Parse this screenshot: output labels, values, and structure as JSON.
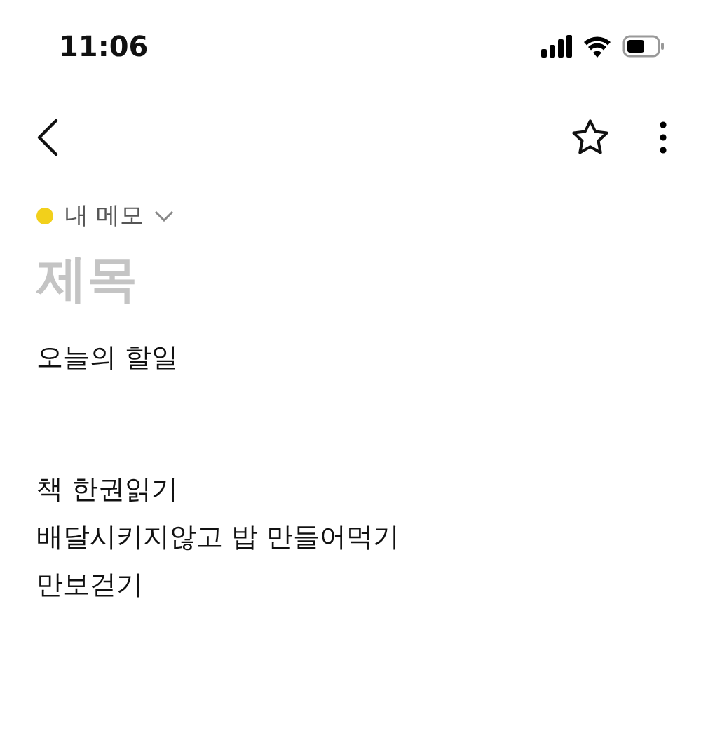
{
  "status_bar": {
    "time": "11:06"
  },
  "note": {
    "folder": {
      "name": "내 메모",
      "color": "#f2d01b"
    },
    "title": {
      "placeholder": "제목"
    },
    "blocks": [
      {
        "lines": [
          "오늘의 할일"
        ]
      },
      {
        "lines": [
          "책 한권읽기",
          "배달시키지않고 밥 만들어먹기",
          "만보걷기"
        ]
      }
    ]
  }
}
